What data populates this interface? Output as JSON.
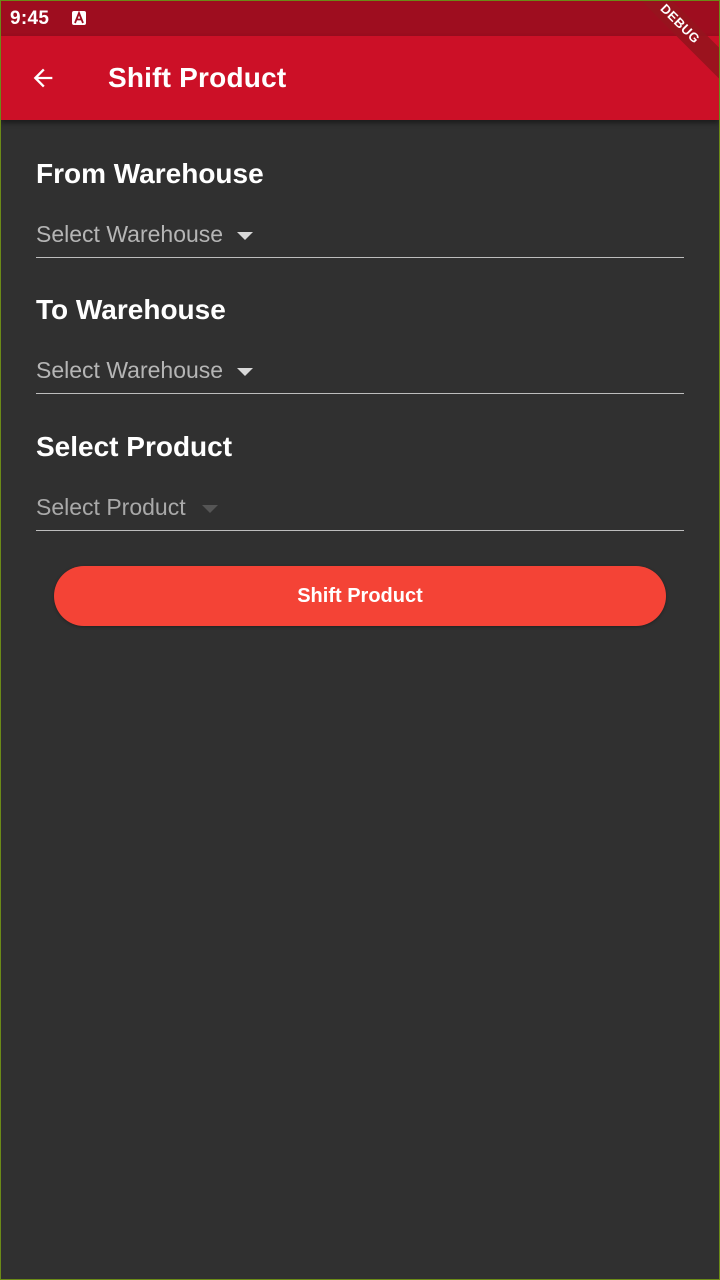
{
  "status_bar": {
    "time": "9:45",
    "notification_icon": "a-notification-icon"
  },
  "app_bar": {
    "back_icon": "arrow-left-icon",
    "title": "Shift Product",
    "debug_banner": "DEBUG"
  },
  "form": {
    "from_warehouse": {
      "label": "From Warehouse",
      "placeholder": "Select Warehouse"
    },
    "to_warehouse": {
      "label": "To Warehouse",
      "placeholder": "Select Warehouse"
    },
    "product": {
      "label": "Select Product",
      "placeholder": "Select Product",
      "enabled": false
    },
    "submit_label": "Shift Product"
  },
  "colors": {
    "status_bar": "#9e0d1f",
    "app_bar": "#cc1027",
    "background": "#303030",
    "button": "#f44336"
  }
}
